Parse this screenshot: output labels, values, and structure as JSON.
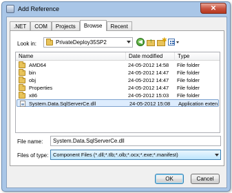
{
  "window": {
    "title": "Add Reference",
    "close_glyph": "✕"
  },
  "tabs": [
    {
      "label": ".NET",
      "active": false
    },
    {
      "label": "COM",
      "active": false
    },
    {
      "label": "Projects",
      "active": false
    },
    {
      "label": "Browse",
      "active": true
    },
    {
      "label": "Recent",
      "active": false
    }
  ],
  "lookin": {
    "label": "Look in:",
    "value": "PrivateDeploy35SP2"
  },
  "toolbar": {
    "back_glyph": "◀",
    "up_glyph": "↑",
    "new_glyph": "✱"
  },
  "list": {
    "columns": [
      "Name",
      "Date modified",
      "Type"
    ],
    "rows": [
      {
        "name": "AMD64",
        "date": "24-05-2012 14:58",
        "type": "File folder",
        "icon": "folder-icon",
        "selected": false
      },
      {
        "name": "bin",
        "date": "24-05-2012 14:47",
        "type": "File folder",
        "icon": "folder-icon",
        "selected": false
      },
      {
        "name": "obj",
        "date": "24-05-2012 14:47",
        "type": "File folder",
        "icon": "folder-icon",
        "selected": false
      },
      {
        "name": "Properties",
        "date": "24-05-2012 14:47",
        "type": "File folder",
        "icon": "folder-icon",
        "selected": false
      },
      {
        "name": "x86",
        "date": "24-05-2012 15:03",
        "type": "File folder",
        "icon": "folder-icon",
        "selected": false
      },
      {
        "name": "System.Data.SqlServerCe.dll",
        "date": "24-05-2012 15:08",
        "type": "Application exten",
        "icon": "dll-icon",
        "selected": true
      }
    ]
  },
  "filename": {
    "label": "File name:",
    "value": "System.Data.SqlServerCe.dll"
  },
  "filetype": {
    "label": "Files of type:",
    "value": "Component Files (*.dll;*.tlb;*.olb;*.ocx;*.exe;*.manifest)"
  },
  "buttons": {
    "ok": "OK",
    "cancel": "Cancel"
  }
}
